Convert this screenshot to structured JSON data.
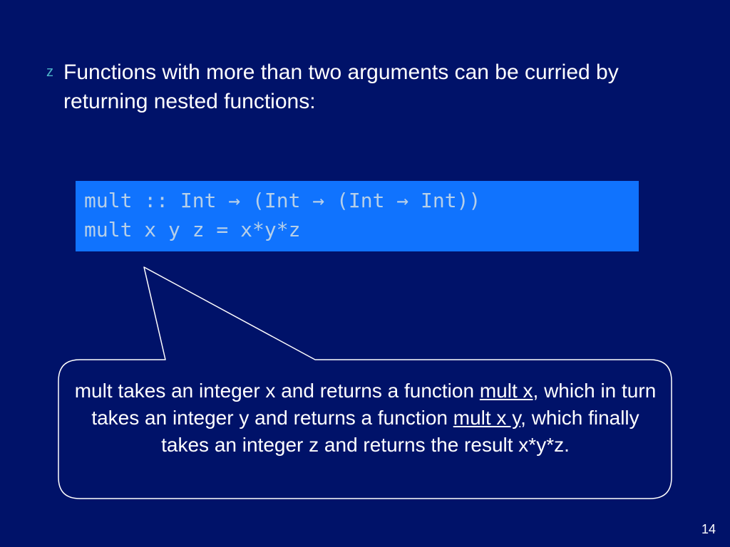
{
  "bullet": {
    "marker": "z",
    "text": "Functions with more than two arguments can be curried by returning nested functions:"
  },
  "code": {
    "line1": "mult :: Int → (Int → (Int → Int))",
    "line2": "mult x y z = x*y*z"
  },
  "callout": {
    "seg1": "mult takes an integer x and returns a function ",
    "u1": "mult x",
    "seg2": ", which in turn takes an integer y and returns a function ",
    "u2": "mult x y",
    "seg3": ", which finally takes an integer z and returns the result x*y*z."
  },
  "page_number": "14"
}
